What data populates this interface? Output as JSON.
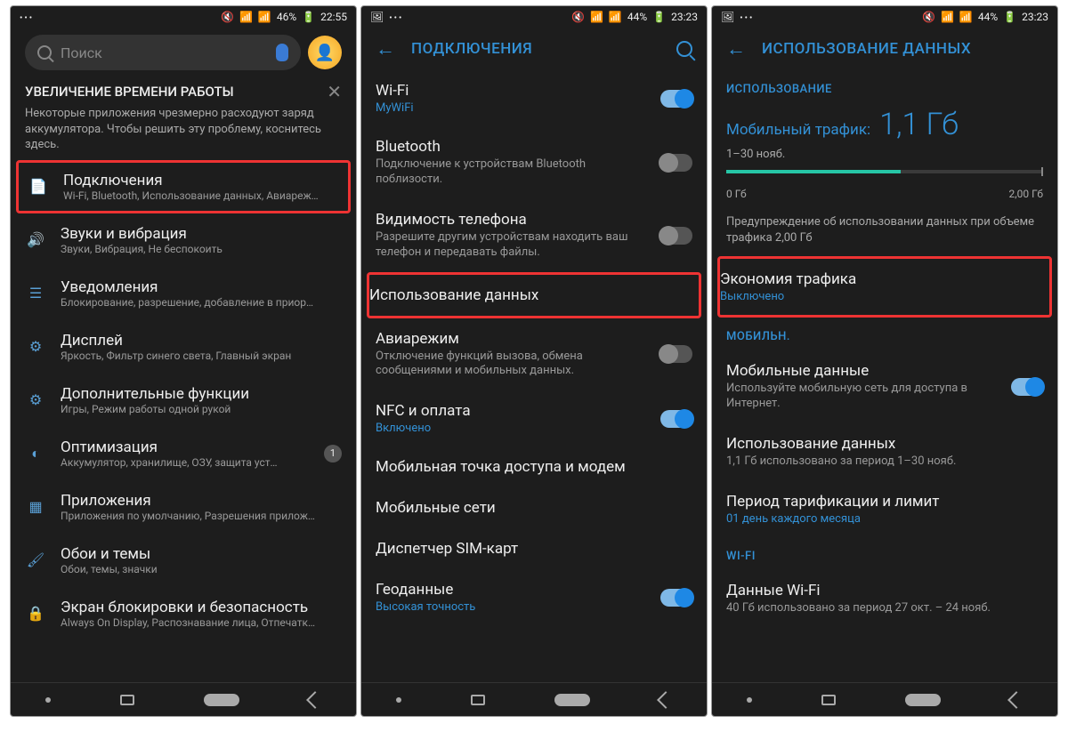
{
  "screen1": {
    "status": {
      "left": "•••",
      "battery": "46%",
      "time": "22:55"
    },
    "search_placeholder": "Поиск",
    "tip": {
      "title": "УВЕЛИЧЕНИЕ ВРЕМЕНИ РАБОТЫ",
      "body": "Некоторые приложения чрезмерно расходуют заряд аккумулятора. Чтобы решить эту проблему, коснитесь здесь."
    },
    "items": [
      {
        "title": "Подключения",
        "sub": "Wi-Fi, Bluetooth, Использование данных, Авиареж…",
        "highlight": true
      },
      {
        "title": "Звуки и вибрация",
        "sub": "Звуки, Вибрация, Не беспокоить"
      },
      {
        "title": "Уведомления",
        "sub": "Блокирование, разрешение, добавление в приор…"
      },
      {
        "title": "Дисплей",
        "sub": "Яркость, Фильтр синего света, Главный экран"
      },
      {
        "title": "Дополнительные функции",
        "sub": "Игры, Режим работы одной рукой"
      },
      {
        "title": "Оптимизация",
        "sub": "Аккумулятор, хранилище, ОЗУ, защита уст…",
        "badge": "1"
      },
      {
        "title": "Приложения",
        "sub": "Приложения по умолчанию, Разрешения прилож…"
      },
      {
        "title": "Обои и темы",
        "sub": "Обои, темы, значки"
      },
      {
        "title": "Экран блокировки и безопасность",
        "sub": "Always On Display, Распознавание лица, Отпечатк…"
      }
    ]
  },
  "screen2": {
    "status": {
      "battery": "44%",
      "time": "23:23"
    },
    "header": "ПОДКЛЮЧЕНИЯ",
    "rows": [
      {
        "title": "Wi-Fi",
        "sub": "MyWiFi",
        "sub_blue": true,
        "toggle": "on"
      },
      {
        "title": "Bluetooth",
        "sub": "Подключение к устройствам Bluetooth поблизости.",
        "toggle": "off"
      },
      {
        "title": "Видимость телефона",
        "sub": "Разрешите другим устройствам находить ваш телефон и передавать файлы.",
        "toggle": "off"
      },
      {
        "title": "Использование данных",
        "highlight": true
      },
      {
        "title": "Авиарежим",
        "sub": "Отключение функций вызова, обмена сообщениями и мобильных данных.",
        "toggle": "off"
      },
      {
        "title": "NFC и оплата",
        "sub": "Включено",
        "sub_blue": true,
        "toggle": "on"
      },
      {
        "title": "Мобильная точка доступа и модем"
      },
      {
        "title": "Мобильные сети"
      },
      {
        "title": "Диспетчер SIM-карт"
      },
      {
        "title": "Геоданные",
        "sub": "Высокая точность",
        "sub_blue": true,
        "toggle": "on"
      }
    ]
  },
  "screen3": {
    "status": {
      "battery": "44%",
      "time": "23:23"
    },
    "header": "ИСПОЛЬЗОВАНИЕ ДАННЫХ",
    "section_usage": "ИСПОЛЬЗОВАНИЕ",
    "traffic_label": "Мобильный трафик:",
    "traffic_value": "1,1 Гб",
    "period": "1–30 нояб.",
    "bar_min": "0 Гб",
    "bar_max": "2,00 Гб",
    "warning": "Предупреждение об использовании данных при объеме трафика 2,00 Гб",
    "saver": {
      "title": "Экономия трафика",
      "sub": "Выключено"
    },
    "section_mobile": "МОБИЛЬН.",
    "mobile_data": {
      "title": "Мобильные данные",
      "sub": "Используйте мобильную сеть для доступа в Интернет."
    },
    "data_usage": {
      "title": "Использование данных",
      "sub": "1,1 Гб использовано за период 1–30 нояб."
    },
    "billing": {
      "title": "Период тарификации и лимит",
      "sub": "01 день каждого месяца"
    },
    "section_wifi": "WI-FI",
    "wifi_data": {
      "title": "Данные Wi-Fi",
      "sub": "40 Гб использовано за период 27 окт. – 24 нояб."
    }
  }
}
